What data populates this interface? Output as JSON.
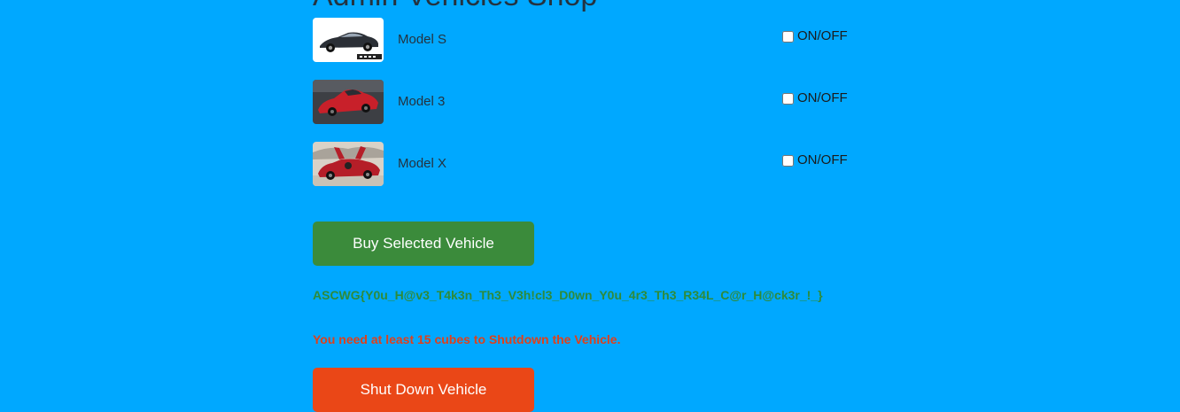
{
  "page": {
    "title": "Admin Vehicles Shop"
  },
  "vehicles": [
    {
      "name": "Model S",
      "toggle_label": "ON/OFF",
      "checked": false,
      "car_color": "#2b2f36",
      "bg_color": "#ffffff"
    },
    {
      "name": "Model 3",
      "toggle_label": "ON/OFF",
      "checked": false,
      "car_color": "#c8202a",
      "bg_color": "#3d3f44"
    },
    {
      "name": "Model X",
      "toggle_label": "ON/OFF",
      "checked": false,
      "car_color": "#b51e28",
      "bg_color": "#d9d2c7"
    }
  ],
  "actions": {
    "buy_label": "Buy Selected Vehicle",
    "shutdown_label": "Shut Down Vehicle"
  },
  "messages": {
    "flag": "ASCWG{Y0u_H@v3_T4k3n_Th3_V3h!cl3_D0wn_Y0u_4r3_Th3_R34L_C@r_H@ck3r_!_}",
    "warning": "You need at least 15 cubes to Shutdown the Vehicle."
  },
  "colors": {
    "background": "#00a8ff",
    "buy_button": "#3b8b3b",
    "shutdown_button": "#ea4717",
    "flag_text": "#2e8b3a",
    "warning_text": "#e0401a"
  }
}
